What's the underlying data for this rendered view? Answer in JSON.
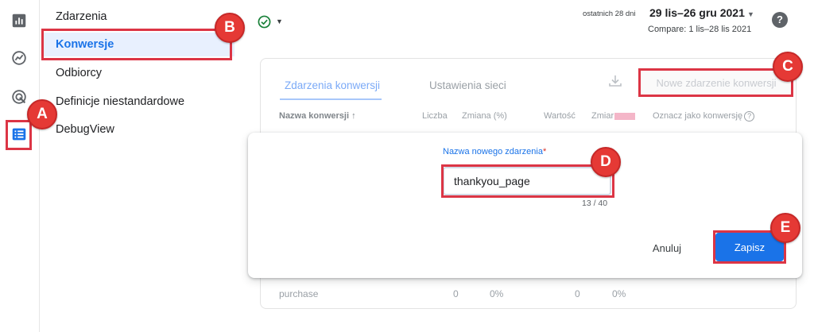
{
  "nav": {
    "items": [
      {
        "label": "Zdarzenia"
      },
      {
        "label": "Konwersje",
        "active": true
      },
      {
        "label": "Odbiorcy"
      },
      {
        "label": "Definicje niestandardowe"
      },
      {
        "label": "DebugView"
      }
    ]
  },
  "rail": {
    "icons": [
      "reports-icon",
      "explore-icon",
      "advertising-icon",
      "configure-icon"
    ]
  },
  "header": {
    "range_label": "ostatnich 28 dni",
    "range_value": "29 lis–26 gru 2021",
    "compare": "Compare: 1 lis–28 lis 2021",
    "help": "?"
  },
  "card": {
    "tabs": [
      "Zdarzenia konwersji",
      "Ustawienia sieci"
    ],
    "new_event_button": "Nowe zdarzenie konwersji",
    "columns": {
      "name": "Nazwa konwersji ↑",
      "count": "Liczba",
      "change": "Zmiana (%)",
      "value": "Wartość",
      "change2": "Zmiar",
      "mark": "Oznacz jako konwersję"
    },
    "row": {
      "name": "purchase",
      "count": "0",
      "change": "0%",
      "value": "0",
      "change2": "0%"
    }
  },
  "dialog": {
    "label": "Nazwa nowego zdarzenia",
    "required": "*",
    "value": "thankyou_page",
    "counter": "13 / 40",
    "cancel": "Anuluj",
    "save": "Zapisz"
  },
  "annotations": {
    "markers": [
      "A",
      "B",
      "C",
      "D",
      "E"
    ],
    "color": "#e53935"
  },
  "colors": {
    "accent": "#1a73e8",
    "active_bg": "#e8f0fe",
    "success": "#188038"
  }
}
